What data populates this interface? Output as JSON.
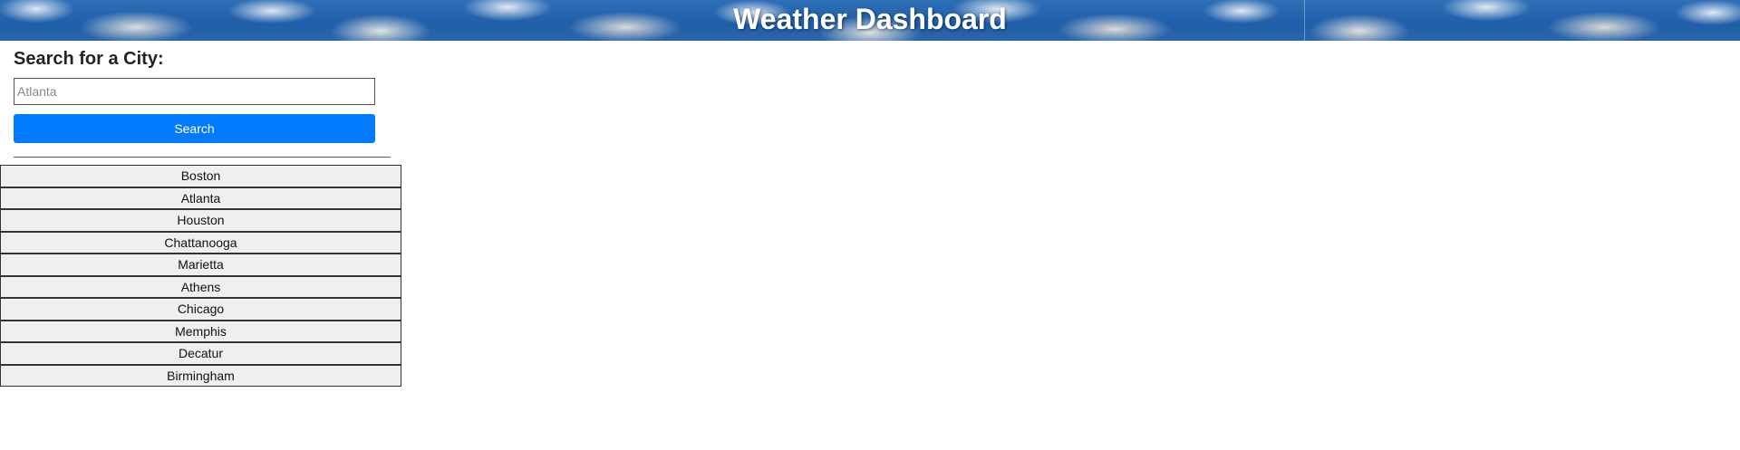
{
  "header": {
    "title": "Weather Dashboard"
  },
  "search": {
    "label": "Search for a City:",
    "placeholder": "Atlanta",
    "value": "",
    "button_label": "Search"
  },
  "history": {
    "cities": [
      {
        "label": "Boston"
      },
      {
        "label": "Atlanta"
      },
      {
        "label": "Houston"
      },
      {
        "label": "Chattanooga"
      },
      {
        "label": "Marietta"
      },
      {
        "label": "Athens"
      },
      {
        "label": "Chicago"
      },
      {
        "label": "Memphis"
      },
      {
        "label": "Decatur"
      },
      {
        "label": "Birmingham"
      }
    ]
  },
  "colors": {
    "accent": "#007bff",
    "list_bg": "#efefef",
    "header_sky": "#2f6fb8"
  }
}
